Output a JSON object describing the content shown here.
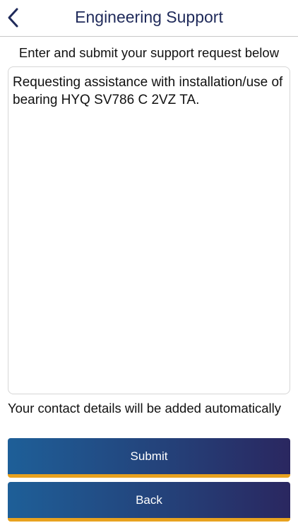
{
  "header": {
    "title": "Engineering Support",
    "back_icon": "chevron-left-icon"
  },
  "instruction": "Enter and submit your support request below",
  "request": {
    "value": "Requesting assistance with installation/use of bearing HYQ SV786 C 2VZ TA."
  },
  "contact_note": "Your contact details will be added automatically",
  "buttons": {
    "submit_label": "Submit",
    "back_label": "Back"
  },
  "colors": {
    "title": "#1f2a5a",
    "button_gradient_start": "#1e5f98",
    "button_gradient_end": "#2a2760",
    "button_underline": "#e8a21f"
  }
}
